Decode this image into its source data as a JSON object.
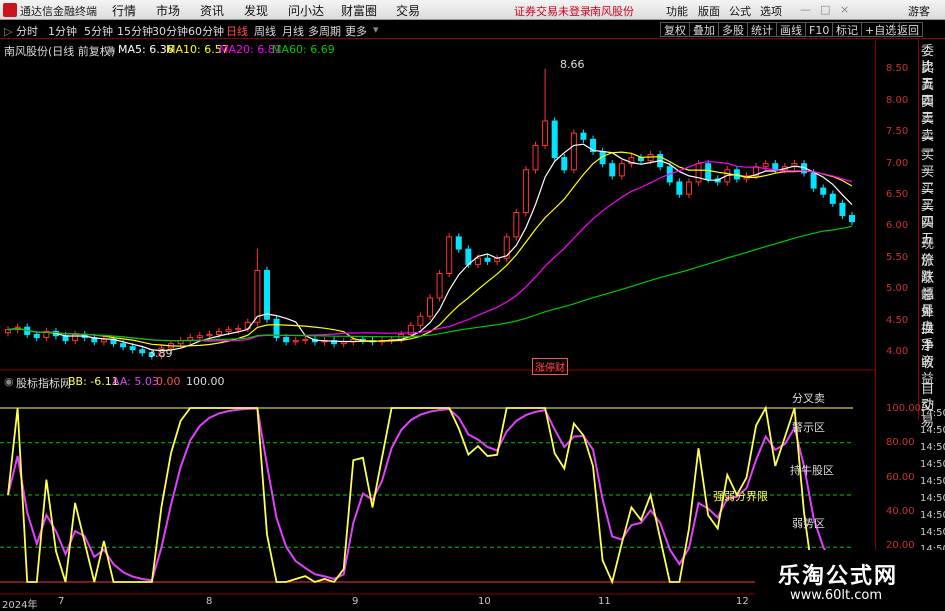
{
  "menubar": {
    "title": "通达信金融终端",
    "items": [
      "行情",
      "市场",
      "资讯",
      "发现",
      "问小达",
      "财富圈",
      "交易"
    ],
    "warning": "证券交易未登录",
    "stock_name": "南风股份",
    "right": [
      "功能",
      "版面",
      "公式",
      "选项"
    ],
    "guest": "游客"
  },
  "periodbar": {
    "items": [
      "分时",
      "1分钟",
      "5分钟",
      "15分钟",
      "30分钟",
      "60分钟",
      "日线",
      "周线",
      "月线",
      "多周期",
      "更多"
    ],
    "active": "日线",
    "tools": [
      "复权",
      "叠加",
      "多股",
      "统计",
      "画线",
      "F10",
      "标记",
      "+自选",
      "返回"
    ]
  },
  "main_info": {
    "stock": "南风股份(日线 前复权)",
    "ma5": "MA5: 6.36",
    "ma10": "MA10: 6.57",
    "ma20": "MA20: 6.81",
    "ma60": "MA60: 6.69",
    "high_label": "8.66",
    "low_label": "3.89",
    "tag": "涨停财"
  },
  "right_panel": [
    "委比",
    "卖五",
    "卖四",
    "卖三",
    "卖二",
    "卖一",
    "买一",
    "买二",
    "买三",
    "买四",
    "买五",
    "现价",
    "涨跌",
    "涨幅",
    "总量",
    "外盘",
    "换手",
    "净资",
    "收益",
    "自动",
    "交易"
  ],
  "price_axis": [
    "8.50",
    "8.00",
    "7.50",
    "7.00",
    "6.50",
    "6.00",
    "5.50",
    "5.00",
    "4.50",
    "4.00"
  ],
  "indicator": {
    "name": "股标指标网",
    "bb": "BB: -6.11",
    "aa": "AA: 5.03",
    "v0": "0.00",
    "v100": "100.00",
    "labels": {
      "sell": "分叉卖",
      "warn": "警示区",
      "hold": "持牛股区",
      "strong": "强弱分界限",
      "weak": "弱势区"
    },
    "axis": [
      "100.00",
      "80.00",
      "60.00",
      "40.00",
      "20.00"
    ]
  },
  "time_axis": [
    "14:50",
    "14:50",
    "14:50",
    "14:50",
    "14:50",
    "14:50",
    "14:50",
    "14:50",
    "14:50",
    "14:50"
  ],
  "x_axis": [
    "2024年",
    "7",
    "8",
    "9",
    "10",
    "11",
    "12"
  ],
  "watermark": {
    "line1": "乐淘公式网",
    "line2": "www.60lt.com"
  },
  "colors": {
    "up": "#ff3232",
    "down": "#00e4ff",
    "ma5": "#ffffff",
    "ma10": "#ffff00",
    "ma20": "#ff00ff",
    "ma60": "#00c800",
    "bb": "#ffff50",
    "aa": "#e040ff"
  },
  "chart_data": {
    "type": "candlestick",
    "xlabel": "",
    "ylabel": "",
    "ylim": [
      3.8,
      8.8
    ],
    "close": [
      4.38,
      4.42,
      4.3,
      4.25,
      4.35,
      4.28,
      4.2,
      4.3,
      4.25,
      4.18,
      4.22,
      4.15,
      4.1,
      4.05,
      4.0,
      3.95,
      4.08,
      4.15,
      4.2,
      4.25,
      4.28,
      4.3,
      4.35,
      4.38,
      4.4,
      4.5,
      5.35,
      4.55,
      4.25,
      4.18,
      4.2,
      4.22,
      4.18,
      4.2,
      4.15,
      4.18,
      4.22,
      4.2,
      4.18,
      4.2,
      4.22,
      4.3,
      4.45,
      4.6,
      4.9,
      5.3,
      5.9,
      5.7,
      5.45,
      5.55,
      5.5,
      5.55,
      5.9,
      6.3,
      7.0,
      7.4,
      7.8,
      7.2,
      7.0,
      7.6,
      7.5,
      7.3,
      7.1,
      6.9,
      7.1,
      7.2,
      7.15,
      7.25,
      7.05,
      6.8,
      6.6,
      6.8,
      7.1,
      6.85,
      6.8,
      7.0,
      6.85,
      6.9,
      7.05,
      7.1,
      7.0,
      7.05,
      7.1,
      6.95,
      6.7,
      6.6,
      6.45,
      6.25,
      6.15
    ]
  }
}
